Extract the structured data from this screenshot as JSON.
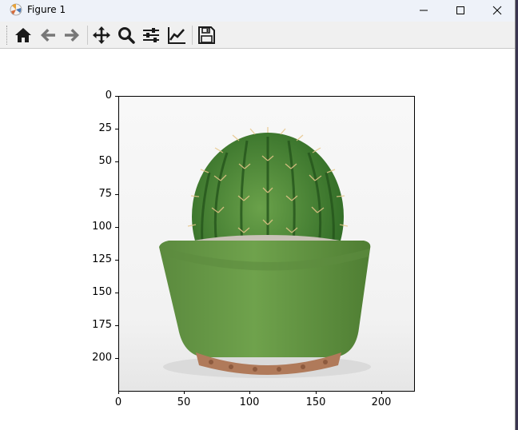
{
  "window": {
    "title": "Figure 1"
  },
  "toolbar": {
    "buttons": [
      {
        "name": "home",
        "icon": "home-icon"
      },
      {
        "name": "back",
        "icon": "arrow-left-icon"
      },
      {
        "name": "forward",
        "icon": "arrow-right-icon"
      },
      {
        "name": "pan",
        "icon": "move-icon"
      },
      {
        "name": "zoom",
        "icon": "magnifier-icon"
      },
      {
        "name": "subplots",
        "icon": "sliders-icon"
      },
      {
        "name": "customize",
        "icon": "line-chart-icon"
      },
      {
        "name": "save",
        "icon": "floppy-disk-icon"
      }
    ]
  },
  "axes": {
    "yticks": [
      "0",
      "25",
      "50",
      "75",
      "100",
      "125",
      "150",
      "175",
      "200"
    ],
    "xticks": [
      "0",
      "50",
      "100",
      "150",
      "200"
    ],
    "image_content": "cactus-in-green-pot"
  },
  "colors": {
    "pot": "#6a9a48",
    "cactus": "#4f8a35",
    "gravel": "#b07a5a"
  }
}
